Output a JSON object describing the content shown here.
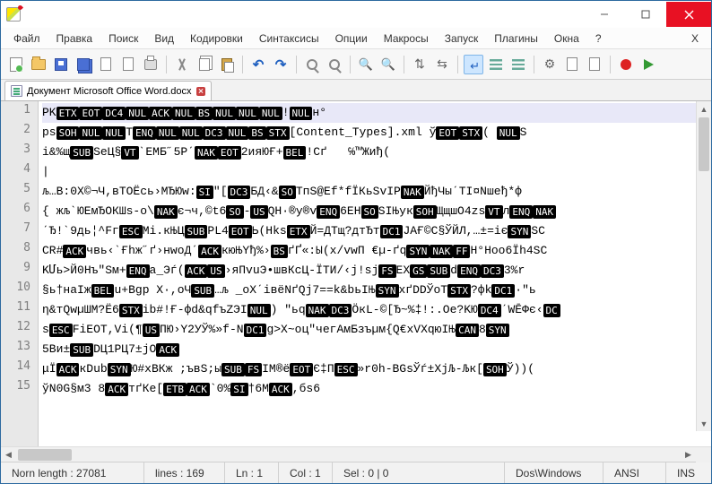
{
  "menubar": [
    "Файл",
    "Правка",
    "Поиск",
    "Вид",
    "Кодировки",
    "Синтаксисы",
    "Опции",
    "Макросы",
    "Запуск",
    "Плагины",
    "Окна",
    "?"
  ],
  "menubar_x": "X",
  "tab": {
    "label": "Документ Microsoft Office Word.docx"
  },
  "toolbar": [
    {
      "name": "new-file-icon",
      "cls": "i-newdoc"
    },
    {
      "name": "open-file-icon",
      "cls": "i-openfold"
    },
    {
      "name": "save-icon",
      "cls": "i-save"
    },
    {
      "name": "save-all-icon",
      "cls": "i-saveall"
    },
    {
      "name": "close-icon",
      "cls": "i-doc"
    },
    {
      "name": "close-all-icon",
      "cls": "i-doc"
    },
    {
      "name": "print-icon",
      "cls": "i-print"
    },
    {
      "sep": true
    },
    {
      "name": "cut-icon",
      "cls": "i-cut"
    },
    {
      "name": "copy-icon",
      "cls": "i-copy"
    },
    {
      "name": "paste-icon",
      "cls": "i-paste"
    },
    {
      "sep": true
    },
    {
      "name": "undo-icon",
      "cls": "i-undo",
      "text": "↶"
    },
    {
      "name": "redo-icon",
      "cls": "i-redo",
      "text": "↷"
    },
    {
      "sep": true
    },
    {
      "name": "find-icon",
      "cls": "i-find"
    },
    {
      "name": "replace-icon",
      "cls": "i-find"
    },
    {
      "sep": true
    },
    {
      "name": "zoom-in-icon",
      "cls": "i-zoom",
      "text": "🔍"
    },
    {
      "name": "zoom-out-icon",
      "cls": "i-zoom",
      "text": "🔍"
    },
    {
      "sep": true
    },
    {
      "name": "sync-v-icon",
      "cls": "i-gear",
      "text": "⇅"
    },
    {
      "name": "sync-h-icon",
      "cls": "i-gear",
      "text": "⇆"
    },
    {
      "sep": true
    },
    {
      "name": "wrap-icon",
      "cls": "i-wrap",
      "active": true
    },
    {
      "name": "all-chars-icon",
      "cls": "i-lines"
    },
    {
      "name": "indent-guide-icon",
      "cls": "i-lines"
    },
    {
      "sep": true
    },
    {
      "name": "lang-icon",
      "cls": "i-gear",
      "text": "⚙"
    },
    {
      "name": "doc-map-icon",
      "cls": "i-doc"
    },
    {
      "name": "func-list-icon",
      "cls": "i-doc"
    },
    {
      "sep": true
    },
    {
      "name": "record-icon",
      "cls": "i-rec"
    },
    {
      "name": "play-icon",
      "cls": "i-play"
    }
  ],
  "lines": [
    [
      {
        "t": "PK"
      },
      {
        "c": "ETX"
      },
      {
        "c": "EOT"
      },
      {
        "c": "DC4"
      },
      {
        "c": "NUL"
      },
      {
        "c": "ACK"
      },
      {
        "c": "NUL"
      },
      {
        "c": "BS"
      },
      {
        "c": "NUL"
      },
      {
        "c": "NUL"
      },
      {
        "c": "NUL"
      },
      {
        "t": "!"
      },
      {
        "c": "NUL"
      },
      {
        "t": "н°"
      }
    ],
    [
      {
        "t": "ps"
      },
      {
        "c": "SOH"
      },
      {
        "c": "NUL"
      },
      {
        "c": "NUL"
      },
      {
        "t": "T"
      },
      {
        "c": "ENQ"
      },
      {
        "c": "NUL"
      },
      {
        "c": "NUL"
      },
      {
        "c": "DC3"
      },
      {
        "c": "NUL"
      },
      {
        "c": "BS"
      },
      {
        "c": "STX"
      },
      {
        "t": "[Content_Types].xml ў"
      },
      {
        "c": "EOT"
      },
      {
        "c": "STX"
      },
      {
        "t": "( "
      },
      {
        "c": "NUL"
      },
      {
        "t": "S"
      }
    ],
    [
      {
        "t": "і&%щ"
      },
      {
        "c": "SUB"
      },
      {
        "t": "SeЦ§"
      },
      {
        "c": "VT"
      },
      {
        "t": "ˋЕМБ˝5Рˊ"
      },
      {
        "c": "NAK"
      },
      {
        "c": "EOT"
      },
      {
        "t": "2ияЮҒ+"
      },
      {
        "c": "BEL"
      },
      {
        "t": "!Cґ   ℅™Жиђ("
      }
    ],
    [
      {
        "t": "|"
      }
    ],
    [
      {
        "t": "љ…B:0X©¬Ч,вТОЁсь›МЂЮw:"
      },
      {
        "c": "SI"
      },
      {
        "t": "″["
      },
      {
        "c": "DC3"
      },
      {
        "t": "БД‹&"
      },
      {
        "c": "SO"
      },
      {
        "t": "ТпЅ@Еf*fЇКьЅvІР"
      },
      {
        "c": "NAK"
      },
      {
        "t": "ЙђЧыˊТІ¤Nшеђ*ф "
      }
    ],
    [
      {
        "t": "{ жљˋЮЕмЂОКШs-o\\"
      },
      {
        "c": "NAK"
      },
      {
        "t": "є¬ч,©t6"
      },
      {
        "c": "SO"
      },
      {
        "t": "-"
      },
      {
        "c": "US"
      },
      {
        "t": "QH·®у®v"
      },
      {
        "c": "ENQ"
      },
      {
        "t": "6ЕH"
      },
      {
        "c": "SO"
      },
      {
        "t": "SІЊук"
      },
      {
        "c": "SOH"
      },
      {
        "t": "ЩщшО4zs"
      },
      {
        "c": "VT"
      },
      {
        "t": "л"
      },
      {
        "c": "ENQ"
      },
      {
        "c": "NAK"
      }
    ],
    [
      {
        "t": "ˊЂ!ˋ9дь¦^Fг"
      },
      {
        "c": "ESC"
      },
      {
        "t": "Мі.кЊЦ"
      },
      {
        "c": "SUB"
      },
      {
        "t": "РL4"
      },
      {
        "c": "EOT"
      },
      {
        "t": "Ь(Нks"
      },
      {
        "c": "ETX"
      },
      {
        "t": "Й=ДТщ?дтЂт"
      },
      {
        "c": "DC1"
      },
      {
        "t": "JАҒ©С§ЎЙЛ,…±=іє"
      },
      {
        "c": "SYN"
      },
      {
        "t": "SC"
      }
    ],
    [
      {
        "t": "CR#"
      },
      {
        "c": "ACK"
      },
      {
        "t": "чвь‹ˋҒhж˝ґ›нwоДˊ"
      },
      {
        "c": "ACK"
      },
      {
        "t": "кюЊҮђ%›"
      },
      {
        "c": "BS"
      },
      {
        "t": "ґҐ«:Ы(х/vwП €µ-ґq"
      },
      {
        "c": "SYN"
      },
      {
        "c": "NAK"
      },
      {
        "c": "FF"
      },
      {
        "t": "Н°Ноо6Їh4SC"
      }
    ],
    [
      {
        "t": "KՄь>Й0Нъ″Sм+"
      },
      {
        "c": "ENQ"
      },
      {
        "t": "a_Эѓ("
      },
      {
        "c": "ACK"
      },
      {
        "c": "US"
      },
      {
        "t": "›яПvuЭ•швКсЦ-ЇТИ/‹j!sj"
      },
      {
        "c": "FS"
      },
      {
        "t": "EX"
      },
      {
        "c": "GS"
      },
      {
        "c": "SUB"
      },
      {
        "t": "d"
      },
      {
        "c": "ENQ"
      },
      {
        "c": "DC3"
      },
      {
        "t": "3%r"
      }
    ],
    [
      {
        "t": "§ь†наІж"
      },
      {
        "c": "BEL"
      },
      {
        "t": "u+Bgp X·,оЧ"
      },
      {
        "c": "SUB"
      },
      {
        "t": "…љ _оХˊівёNґQj7==k&bьІЊ"
      },
      {
        "c": "SYN"
      },
      {
        "t": "хґDDЎоТ"
      },
      {
        "c": "STX"
      },
      {
        "t": "?фk"
      },
      {
        "c": "DC1"
      },
      {
        "t": "·″ь"
      }
    ],
    [
      {
        "t": "η&тQwµШМ?Ё6"
      },
      {
        "c": "STX"
      },
      {
        "t": "іb#!Ғ-фd&qfъZЭІ"
      },
      {
        "c": "NUL"
      },
      {
        "t": ") ″ьq"
      },
      {
        "c": "NAK"
      },
      {
        "c": "DC3"
      },
      {
        "t": "ÖкL-©[Ђ~%‡!:.Oe?KЮ"
      },
      {
        "c": "DC4"
      },
      {
        "t": "ˊWĒФє‹"
      },
      {
        "c": "DC"
      }
    ],
    [
      {
        "t": "s"
      },
      {
        "c": "ESC"
      },
      {
        "t": "FiEOT,Vi(¶"
      },
      {
        "c": "US"
      },
      {
        "t": "ПЮ›Y2УЎ%»f-N"
      },
      {
        "c": "DC1"
      },
      {
        "t": "g>X~oц″чегАмБзъµм{Q€хVXqюІЊ"
      },
      {
        "c": "CAN"
      },
      {
        "t": "8"
      },
      {
        "c": "SYN"
      }
    ],
    [
      {
        "t": "5Bи±"
      },
      {
        "c": "SUB"
      },
      {
        "t": "DЦ1РЦ7±jO"
      },
      {
        "c": "ACK"
      }
    ],
    [
      {
        "t": "μÏ"
      },
      {
        "c": "ACK"
      },
      {
        "t": "кDub"
      },
      {
        "c": "SYN"
      },
      {
        "t": "Ю#xBКж ;ъвЅ;ы"
      },
      {
        "c": "SUB"
      },
      {
        "c": "FS"
      },
      {
        "t": "ІМ®ё"
      },
      {
        "c": "EOT"
      },
      {
        "t": "Є‡П"
      },
      {
        "c": "ESC"
      },
      {
        "t": "»r0h-ВGsЎѓ±XjЉ-Љк["
      },
      {
        "c": "SOH"
      },
      {
        "t": "Ў))("
      }
    ],
    [
      {
        "t": "ўN0G§м3 8"
      },
      {
        "c": "ACK"
      },
      {
        "t": "тґКe["
      },
      {
        "c": "ETB"
      },
      {
        "c": "ACK"
      },
      {
        "t": "`0%"
      },
      {
        "c": "SI"
      },
      {
        "t": "†6M"
      },
      {
        "c": "ACK"
      },
      {
        "t": ",бs6 "
      }
    ]
  ],
  "status": {
    "norm": "Norn length : 27081",
    "lines": "lines : 169",
    "ln": "Ln : 1",
    "col": "Col : 1",
    "sel": "Sel : 0 | 0",
    "eol": "Dos\\Windows",
    "enc": "ANSI",
    "mode": "INS"
  }
}
